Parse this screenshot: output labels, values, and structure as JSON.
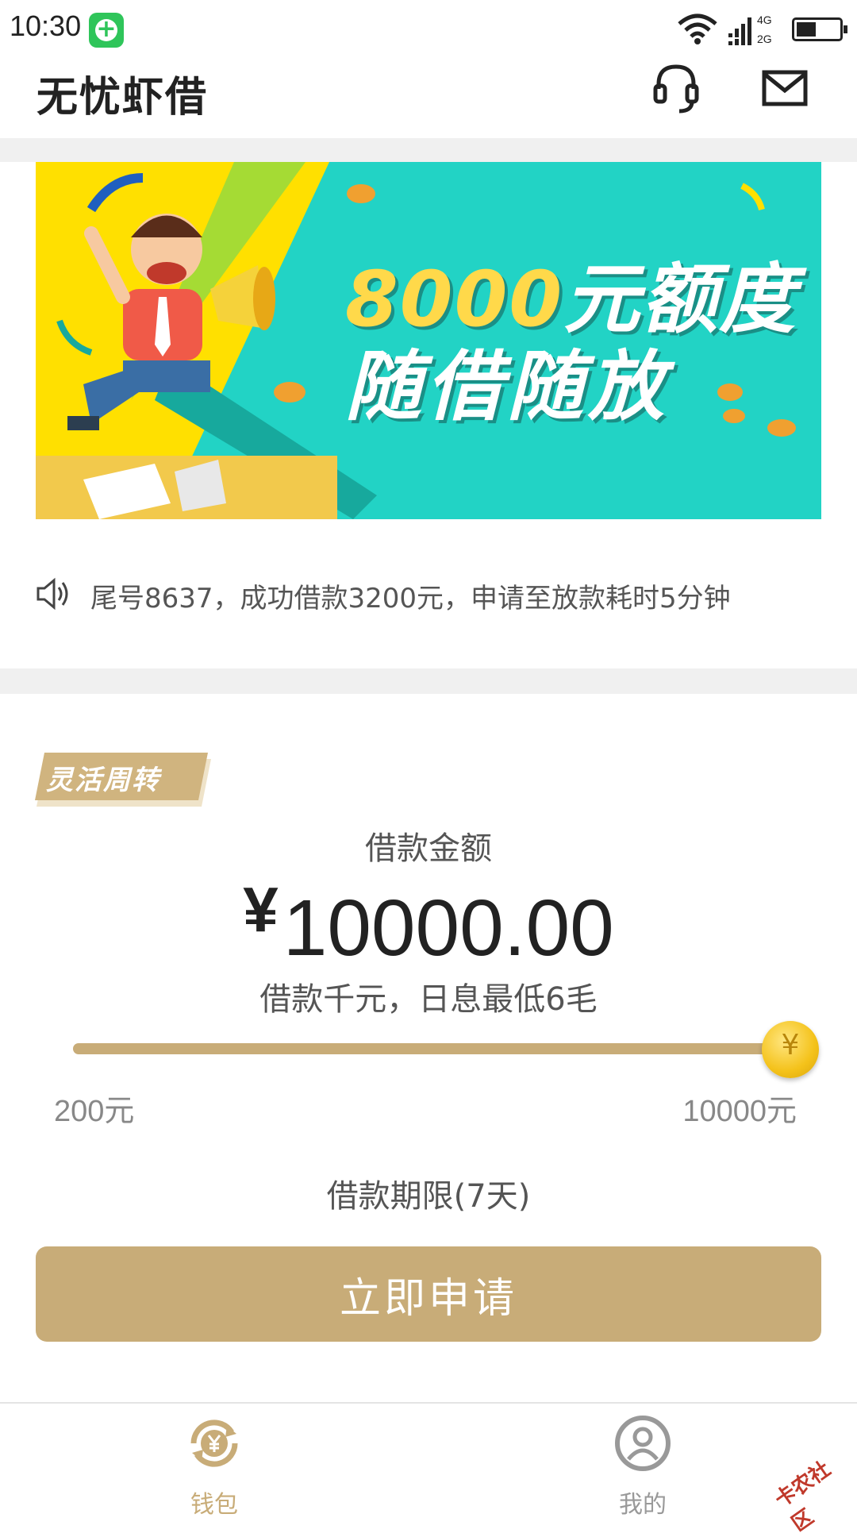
{
  "status_bar": {
    "time": "10:30",
    "network_top": "4G",
    "network_bottom": "2G"
  },
  "header": {
    "title": "无忧虾借",
    "icons": [
      "headset-icon",
      "mail-icon"
    ]
  },
  "banner": {
    "line1_number": "8000",
    "line1_suffix": "元额度",
    "line2": "随借随放"
  },
  "notice": {
    "text": "尾号8637，成功借款3200元，申请至放款耗时5分钟"
  },
  "loan": {
    "tag": "灵活周转",
    "amount_label": "借款金额",
    "currency_symbol": "¥",
    "amount": "10000.00",
    "interest_text": "借款千元，日息最低6毛",
    "slider_min_label": "200元",
    "slider_max_label": "10000元",
    "slider_value_fraction": 1.0,
    "slider_thumb_symbol": "¥",
    "term_text": "借款期限(7天)",
    "apply_label": "立即申请"
  },
  "tabs": [
    {
      "label": "钱包",
      "icon": "wallet-yen-icon",
      "active": true
    },
    {
      "label": "我的",
      "icon": "user-icon",
      "active": false
    }
  ],
  "watermark": "卡农社区",
  "colors": {
    "accent": "#c8ac78",
    "banner_teal": "#22d3c5",
    "banner_yellow": "#ffe000",
    "coin": "#f4c21a",
    "inactive": "#999999"
  }
}
